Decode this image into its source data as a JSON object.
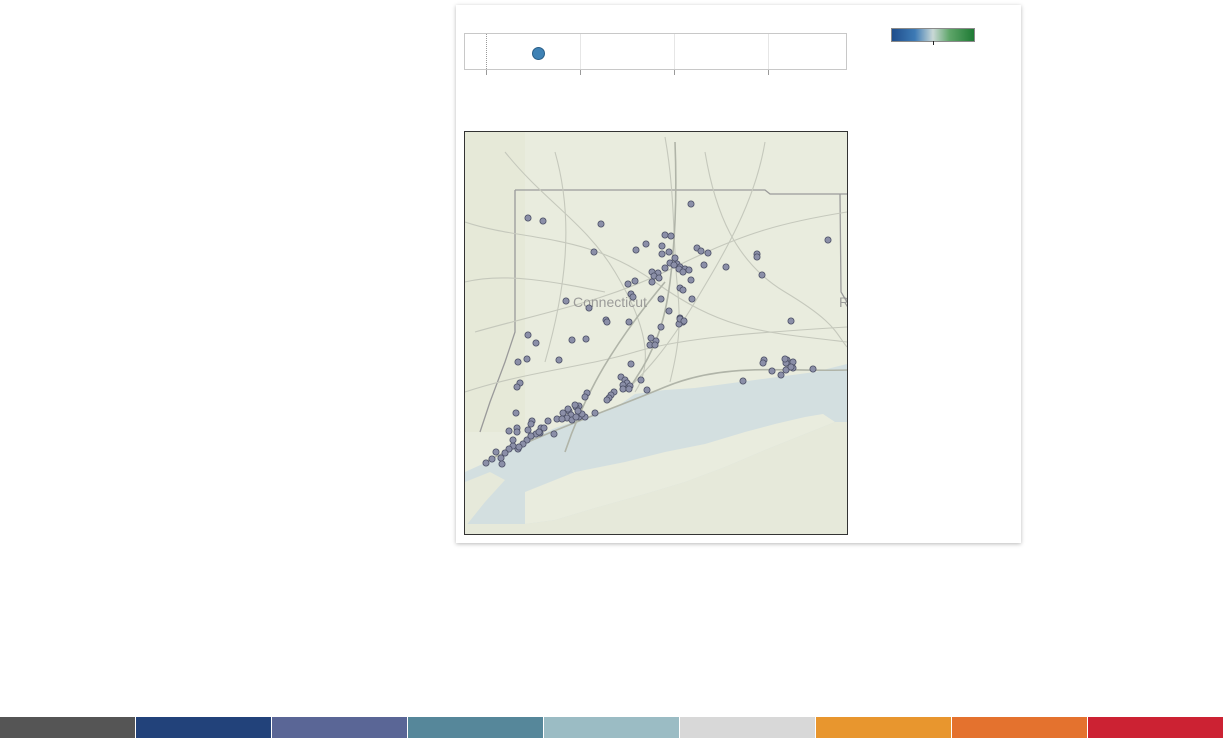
{
  "dashboard": {
    "map": {
      "region_label": "Connecticut",
      "edge_label": "R",
      "location_count": 146
    },
    "strip_plot": {
      "marks": [
        {
          "value_fraction": 0.19
        }
      ]
    },
    "legend": {
      "colors": [
        "#1f4e8c",
        "#3d7ab5",
        "#c9d8d6",
        "#5fa66a",
        "#1e7a34"
      ]
    },
    "footer_palette": [
      "#555555",
      "#22427a",
      "#5a6696",
      "#56879a",
      "#9bbcc4",
      "#d8d8d8",
      "#e8962e",
      "#e4722e",
      "#cc2233"
    ]
  }
}
